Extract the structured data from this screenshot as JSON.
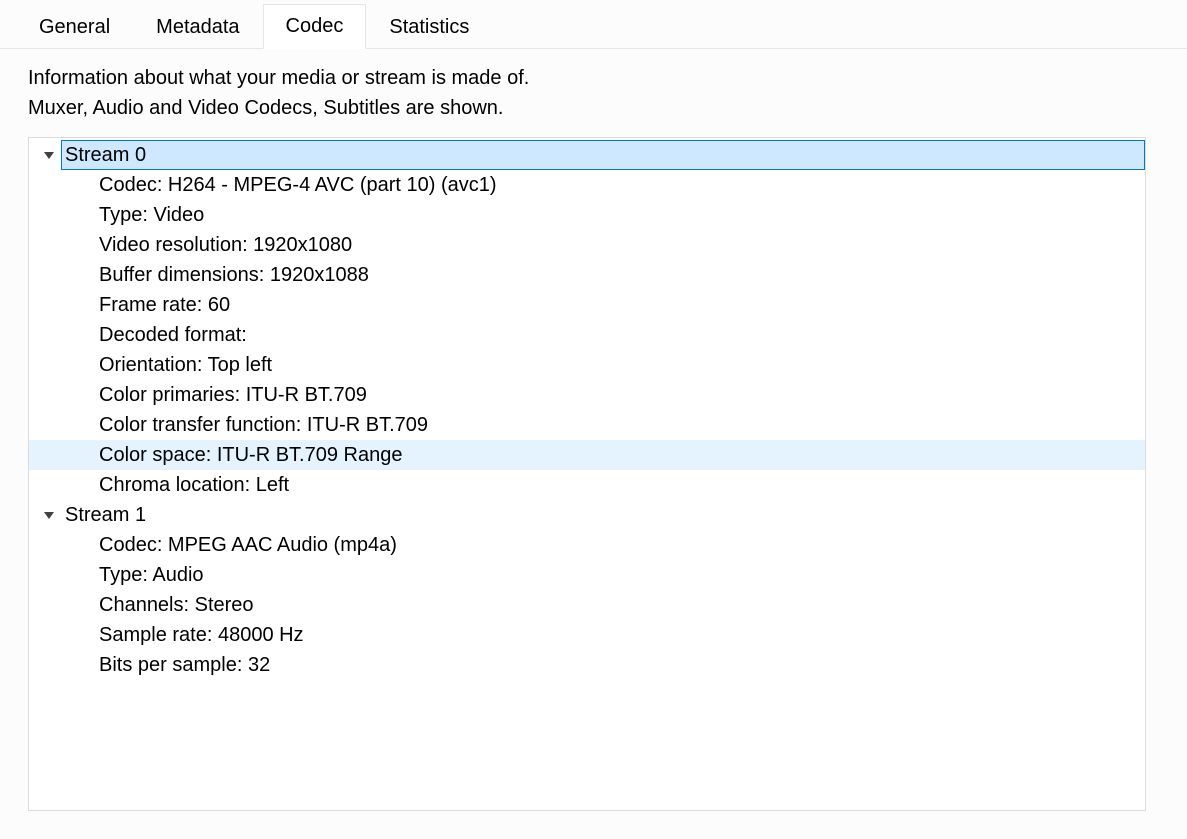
{
  "tabs": {
    "general": "General",
    "metadata": "Metadata",
    "codec": "Codec",
    "statistics": "Statistics"
  },
  "description_line1": "Information about what your media or stream is made of.",
  "description_line2": "Muxer, Audio and Video Codecs, Subtitles are shown.",
  "streams": [
    {
      "title": "Stream 0",
      "props": [
        "Codec: H264 - MPEG-4 AVC (part 10) (avc1)",
        "Type: Video",
        "Video resolution: 1920x1080",
        "Buffer dimensions: 1920x1088",
        "Frame rate: 60",
        "Decoded format:",
        "Orientation: Top left",
        "Color primaries: ITU-R BT.709",
        "Color transfer function: ITU-R BT.709",
        "Color space: ITU-R BT.709 Range",
        "Chroma location: Left"
      ],
      "selected": true,
      "hover_index": 9
    },
    {
      "title": "Stream 1",
      "props": [
        "Codec: MPEG AAC Audio (mp4a)",
        "Type: Audio",
        "Channels: Stereo",
        "Sample rate: 48000 Hz",
        "Bits per sample: 32"
      ],
      "selected": false,
      "hover_index": -1
    }
  ]
}
